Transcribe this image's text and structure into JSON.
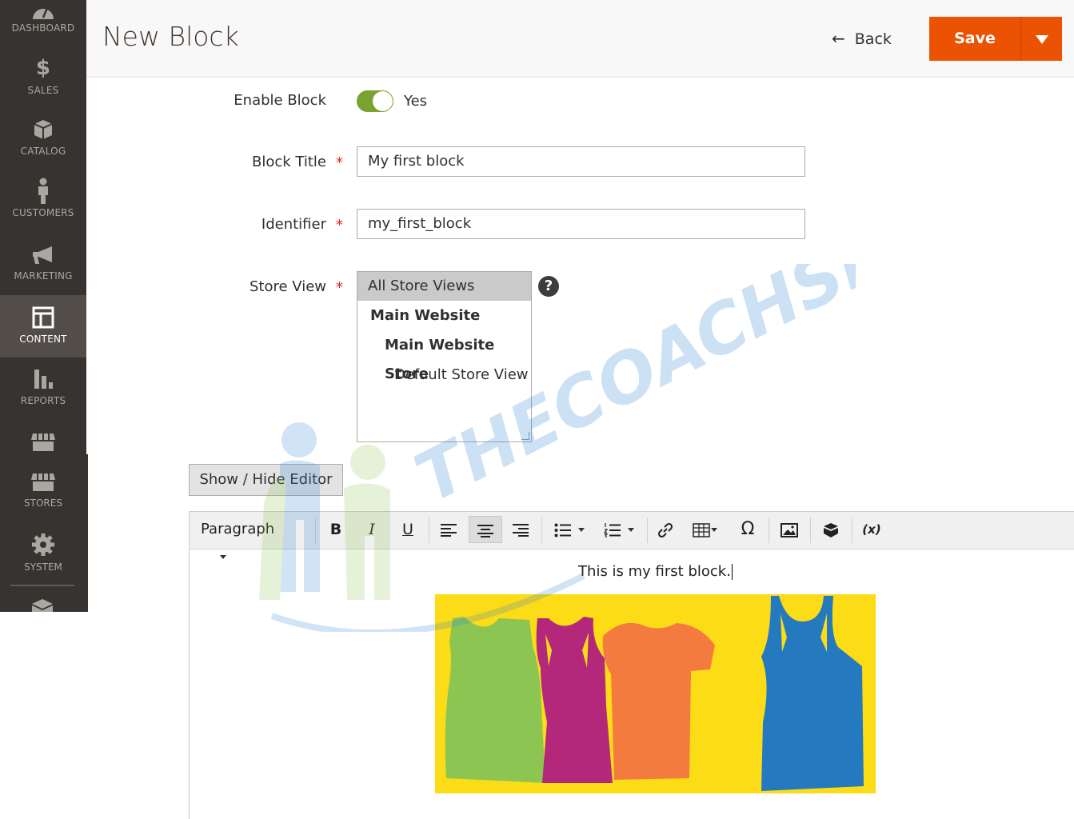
{
  "sidebar": {
    "items": [
      {
        "label": "DASHBOARD",
        "icon": "dashboard-icon"
      },
      {
        "label": "SALES",
        "icon": "dollar-icon"
      },
      {
        "label": "CATALOG",
        "icon": "cube-icon"
      },
      {
        "label": "CUSTOMERS",
        "icon": "person-icon"
      },
      {
        "label": "MARKETING",
        "icon": "megaphone-icon"
      },
      {
        "label": "CONTENT",
        "icon": "layout-icon",
        "active": true
      },
      {
        "label": "REPORTS",
        "icon": "bar-chart-icon"
      },
      {
        "label": "",
        "icon": "storefront-icon"
      },
      {
        "label": "STORES",
        "icon": "storefront-icon"
      },
      {
        "label": "SYSTEM",
        "icon": "gear-icon"
      },
      {
        "label": "",
        "icon": "extensions-icon"
      }
    ]
  },
  "header": {
    "title": "New Block",
    "back_label": "Back",
    "save_label": "Save"
  },
  "form": {
    "enable_block": {
      "label": "Enable Block",
      "value": "Yes",
      "enabled": true
    },
    "block_title": {
      "label": "Block Title",
      "value": "My first block",
      "required_mark": "*"
    },
    "identifier": {
      "label": "Identifier",
      "value": "my_first_block",
      "required_mark": "*"
    },
    "store_view": {
      "label": "Store View",
      "required_mark": "*",
      "help": "?",
      "options": [
        {
          "label": "All Store Views",
          "selected": true
        },
        {
          "label": "Main Website"
        },
        {
          "label": "Main Website Store"
        },
        {
          "label": "Default Store View"
        }
      ]
    },
    "toggle_editor_label": "Show / Hide Editor"
  },
  "editor": {
    "format_select": "Paragraph",
    "toolbar": {
      "bold": "B",
      "italic": "I",
      "underline": "U",
      "special_char": "Ω",
      "variable": "(x)"
    },
    "content_text": "This is my first block."
  },
  "watermark": {
    "text": "THECOACHSMB"
  },
  "colors": {
    "sidebar_bg": "#373330",
    "accent": "#eb5202",
    "toggle_on": "#79a22e",
    "required": "#e22626"
  }
}
